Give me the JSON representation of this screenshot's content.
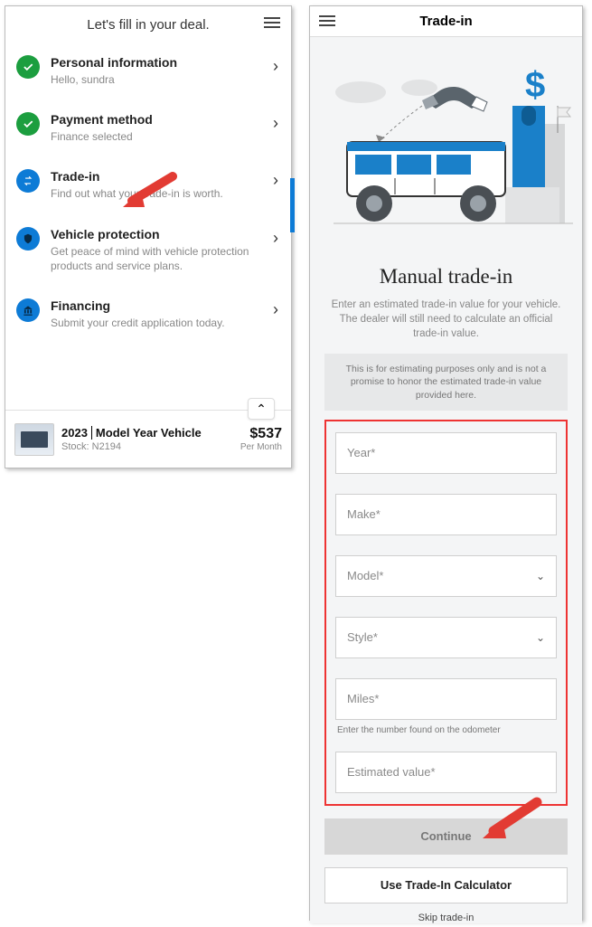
{
  "left": {
    "title": "Let's fill in your deal.",
    "steps": [
      {
        "title": "Personal information",
        "sub": "Hello, sundra",
        "icon": "check",
        "color": "green"
      },
      {
        "title": "Payment method",
        "sub": "Finance selected",
        "icon": "check",
        "color": "green"
      },
      {
        "title": "Trade-in",
        "sub": "Find out what your trade-in is worth.",
        "icon": "swap",
        "color": "blue"
      },
      {
        "title": "Vehicle protection",
        "sub": "Get peace of mind with vehicle protection products and service plans.",
        "icon": "shield",
        "color": "blue"
      },
      {
        "title": "Financing",
        "sub": "Submit your credit application today.",
        "icon": "bank",
        "color": "blue"
      }
    ],
    "vehicle": {
      "year": "2023",
      "name": "Model Year Vehicle",
      "stock": "Stock: N2194",
      "price": "$537",
      "per": "Per Month"
    }
  },
  "right": {
    "header": "Trade-in",
    "title": "Manual trade-in",
    "sub": "Enter an estimated trade-in value for your vehicle. The dealer will still need to calculate an official trade-in value.",
    "note": "This is for estimating purposes only and is not a promise to honor the estimated trade-in value provided here.",
    "fields": {
      "year": "Year*",
      "make": "Make*",
      "model": "Model*",
      "style": "Style*",
      "miles": "Miles*",
      "miles_help": "Enter the number found on the odometer",
      "est": "Estimated value*"
    },
    "buttons": {
      "continue": "Continue",
      "calc": "Use Trade-In Calculator",
      "skip": "Skip trade-in"
    }
  }
}
